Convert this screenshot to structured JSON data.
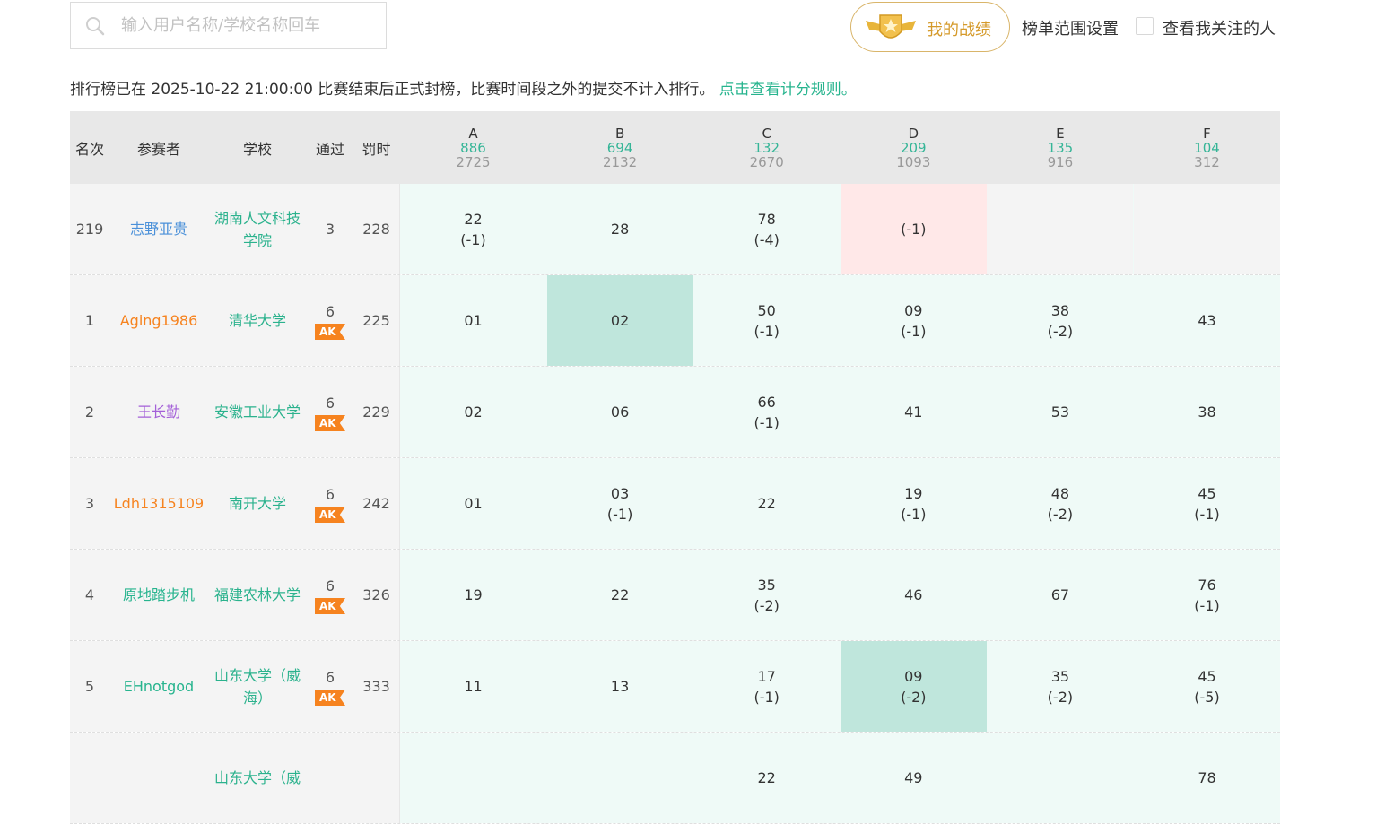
{
  "search": {
    "placeholder": "输入用户名称/学校名称回车"
  },
  "header": {
    "my_record": "我的战绩",
    "range_setting": "榜单范围设置",
    "follow_label": "查看我关注的人"
  },
  "notice": {
    "text": "排行榜已在 2025-10-22 21:00:00 比赛结束后正式封榜，比赛时间段之外的提交不计入排行。",
    "link": "点击查看计分规则。"
  },
  "columns": {
    "rank": "名次",
    "participant": "参赛者",
    "school": "学校",
    "solved": "通过",
    "penalty": "罚时"
  },
  "problems": [
    {
      "letter": "A",
      "pass": "886",
      "try": "2725"
    },
    {
      "letter": "B",
      "pass": "694",
      "try": "2132"
    },
    {
      "letter": "C",
      "pass": "132",
      "try": "2670"
    },
    {
      "letter": "D",
      "pass": "209",
      "try": "1093"
    },
    {
      "letter": "E",
      "pass": "135",
      "try": "916"
    },
    {
      "letter": "F",
      "pass": "104",
      "try": "312"
    }
  ],
  "ak_label": "AK",
  "colors": {
    "accent": "#27b48e",
    "orange": "#f6831f",
    "purple": "#a460d8",
    "blue_name": "#4a90d9"
  },
  "rows": [
    {
      "rank": "219",
      "name": "志野亚贵",
      "name_color": "#4a90d9",
      "school": "湖南人文科技学院",
      "solved": "3",
      "ak": false,
      "penalty": "228",
      "cells": [
        {
          "time": "22",
          "pen": "(-1)",
          "state": "ok"
        },
        {
          "time": "28",
          "pen": "",
          "state": "ok"
        },
        {
          "time": "78",
          "pen": "(-4)",
          "state": "ok"
        },
        {
          "time": "",
          "pen": "(-1)",
          "state": "fail"
        },
        {
          "time": "",
          "pen": "",
          "state": "empty"
        },
        {
          "time": "",
          "pen": "",
          "state": "empty"
        }
      ]
    },
    {
      "rank": "1",
      "name": "Aging1986",
      "name_color": "#f6831f",
      "school": "清华大学",
      "solved": "6",
      "ak": true,
      "penalty": "225",
      "cells": [
        {
          "time": "01",
          "pen": "",
          "state": "ok"
        },
        {
          "time": "02",
          "pen": "",
          "state": "first"
        },
        {
          "time": "50",
          "pen": "(-1)",
          "state": "ok"
        },
        {
          "time": "09",
          "pen": "(-1)",
          "state": "ok"
        },
        {
          "time": "38",
          "pen": "(-2)",
          "state": "ok"
        },
        {
          "time": "43",
          "pen": "",
          "state": "ok"
        }
      ]
    },
    {
      "rank": "2",
      "name": "王长勤",
      "name_color": "#a460d8",
      "school": "安徽工业大学",
      "solved": "6",
      "ak": true,
      "penalty": "229",
      "cells": [
        {
          "time": "02",
          "pen": "",
          "state": "ok"
        },
        {
          "time": "06",
          "pen": "",
          "state": "ok"
        },
        {
          "time": "66",
          "pen": "(-1)",
          "state": "ok"
        },
        {
          "time": "41",
          "pen": "",
          "state": "ok"
        },
        {
          "time": "53",
          "pen": "",
          "state": "ok"
        },
        {
          "time": "38",
          "pen": "",
          "state": "ok"
        }
      ]
    },
    {
      "rank": "3",
      "name": "Ldh1315109",
      "name_color": "#f6831f",
      "school": "南开大学",
      "solved": "6",
      "ak": true,
      "penalty": "242",
      "cells": [
        {
          "time": "01",
          "pen": "",
          "state": "ok"
        },
        {
          "time": "03",
          "pen": "(-1)",
          "state": "ok"
        },
        {
          "time": "22",
          "pen": "",
          "state": "ok"
        },
        {
          "time": "19",
          "pen": "(-1)",
          "state": "ok"
        },
        {
          "time": "48",
          "pen": "(-2)",
          "state": "ok"
        },
        {
          "time": "45",
          "pen": "(-1)",
          "state": "ok"
        }
      ]
    },
    {
      "rank": "4",
      "name": "原地踏步机",
      "name_color": "#27b48e",
      "school": "福建农林大学",
      "solved": "6",
      "ak": true,
      "penalty": "326",
      "cells": [
        {
          "time": "19",
          "pen": "",
          "state": "ok"
        },
        {
          "time": "22",
          "pen": "",
          "state": "ok"
        },
        {
          "time": "35",
          "pen": "(-2)",
          "state": "ok"
        },
        {
          "time": "46",
          "pen": "",
          "state": "ok"
        },
        {
          "time": "67",
          "pen": "",
          "state": "ok"
        },
        {
          "time": "76",
          "pen": "(-1)",
          "state": "ok"
        }
      ]
    },
    {
      "rank": "5",
      "name": "EHnotgod",
      "name_color": "#27b48e",
      "school": "山东大学（威海）",
      "solved": "6",
      "ak": true,
      "penalty": "333",
      "cells": [
        {
          "time": "11",
          "pen": "",
          "state": "ok"
        },
        {
          "time": "13",
          "pen": "",
          "state": "ok"
        },
        {
          "time": "17",
          "pen": "(-1)",
          "state": "ok"
        },
        {
          "time": "09",
          "pen": "(-2)",
          "state": "first"
        },
        {
          "time": "35",
          "pen": "(-2)",
          "state": "ok"
        },
        {
          "time": "45",
          "pen": "(-5)",
          "state": "ok"
        }
      ]
    },
    {
      "rank": "",
      "name": "",
      "name_color": "#27b48e",
      "school": "山东大学（威",
      "solved": "",
      "ak": false,
      "penalty": "",
      "cells": [
        {
          "time": "",
          "pen": "",
          "state": "ok"
        },
        {
          "time": "",
          "pen": "",
          "state": "ok"
        },
        {
          "time": "22",
          "pen": "",
          "state": "ok"
        },
        {
          "time": "49",
          "pen": "",
          "state": "ok"
        },
        {
          "time": "",
          "pen": "",
          "state": "ok"
        },
        {
          "time": "78",
          "pen": "",
          "state": "ok"
        }
      ]
    }
  ]
}
